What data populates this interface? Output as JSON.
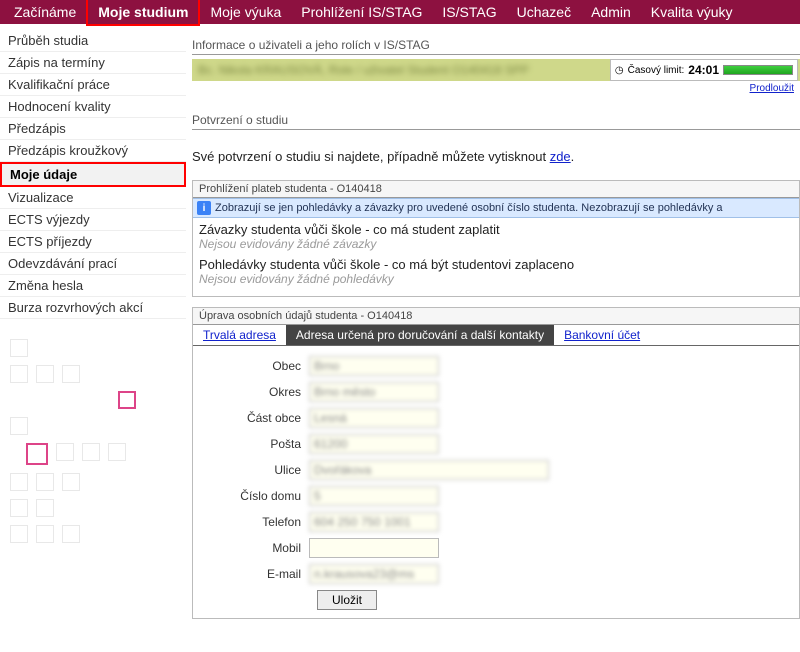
{
  "topnav": {
    "items": [
      {
        "label": "Začínáme"
      },
      {
        "label": "Moje studium",
        "active": true
      },
      {
        "label": "Moje výuka"
      },
      {
        "label": "Prohlížení IS/STAG"
      },
      {
        "label": "IS/STAG"
      },
      {
        "label": "Uchazeč"
      },
      {
        "label": "Admin"
      },
      {
        "label": "Kvalita výuky"
      }
    ]
  },
  "sidebar": {
    "items": [
      {
        "label": "Průběh studia"
      },
      {
        "label": "Zápis na termíny"
      },
      {
        "label": "Kvalifikační práce"
      },
      {
        "label": "Hodnocení kvality"
      },
      {
        "label": "Předzápis"
      },
      {
        "label": "Předzápis kroužkový"
      },
      {
        "label": "Moje údaje",
        "active": true
      },
      {
        "label": "Vizualizace"
      },
      {
        "label": "ECTS výjezdy"
      },
      {
        "label": "ECTS příjezdy"
      },
      {
        "label": "Odevzdávání prací"
      },
      {
        "label": "Změna hesla"
      },
      {
        "label": "Burza rozvrhových akcí"
      }
    ]
  },
  "userinfo": {
    "heading": "Informace o uživateli a jeho rolích v IS/STAG",
    "blurred_text": "Bc. Nikola KRAUSOVÁ, Role / uživatel Student O140418 SPP",
    "timer_label": "Časový limit:",
    "timer_value": "24:01",
    "extend_link": "Prodloužit"
  },
  "confirmation": {
    "heading": "Potvrzení o studiu",
    "text_before": "Své potvrzení o studiu si najdete, případně můžete vytisknout ",
    "link": "zde",
    "text_after": "."
  },
  "payments": {
    "heading": "Prohlížení plateb studenta - O140418",
    "info_text": "Zobrazují se jen pohledávky a závazky pro uvedené osobní číslo studenta. Nezobrazují se pohledávky a",
    "block1_title": "Závazky studenta vůči škole - co má student zaplatit",
    "block1_empty": "Nejsou evidovány žádné závazky",
    "block2_title": "Pohledávky studenta vůči škole - co má být studentovi zaplaceno",
    "block2_empty": "Nejsou evidovány žádné pohledávky"
  },
  "edit": {
    "heading": "Úprava osobních údajů studenta - O140418",
    "tabs": {
      "t1": "Trvalá adresa",
      "t2": "Adresa určená pro doručování a další kontakty",
      "t3": "Bankovní účet"
    },
    "form": {
      "obec": {
        "label": "Obec",
        "value": "Brno"
      },
      "okres": {
        "label": "Okres",
        "value": "Brno město"
      },
      "cast_obce": {
        "label": "Část obce",
        "value": "Lesná"
      },
      "posta": {
        "label": "Pošta",
        "value": "61200"
      },
      "ulice": {
        "label": "Ulice",
        "value": "Dvořákova"
      },
      "cislo_domu": {
        "label": "Číslo domu",
        "value": "5"
      },
      "telefon": {
        "label": "Telefon",
        "value": "604 250 750 1001"
      },
      "mobil": {
        "label": "Mobil",
        "value": ""
      },
      "email": {
        "label": "E-mail",
        "value": "n.krausova23@ms"
      }
    },
    "save": "Uložit"
  }
}
